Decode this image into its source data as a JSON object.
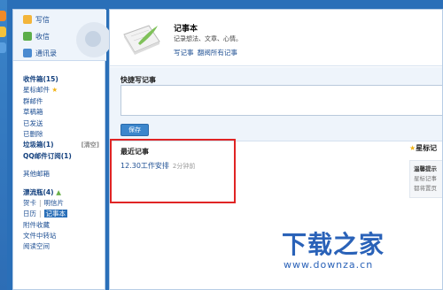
{
  "actions": {
    "write": "写信",
    "receive": "收信",
    "contacts": "通讯录"
  },
  "folders": {
    "inbox": "收件箱(15)",
    "starred": "星标邮件",
    "group": "群邮件",
    "drafts": "草稿箱",
    "sent": "已发送",
    "deleted": "已删除",
    "junk": "垃圾箱(1)",
    "junk_clear": "[清空]",
    "qq_sub": "QQ邮件订阅(1)",
    "other": "其他邮箱",
    "drift": "漂流瓶(4)",
    "card": "贺卡",
    "postcard": "明信片",
    "calendar": "日历",
    "notebook": "记事本",
    "attach": "附件收藏",
    "transfer": "文件中转站",
    "reading": "阅读空间"
  },
  "notebook": {
    "title": "记事本",
    "desc": "记录想法、文章、心情。",
    "write_link": "写记事",
    "browse_link": "翻阅所有记事"
  },
  "quick": {
    "title": "快捷写记事",
    "save": "保存"
  },
  "recent": {
    "title": "最近记事",
    "item": "12.30工作安排",
    "time": "2分钟前"
  },
  "side": {
    "title": "星标记",
    "line1": "温馨提示",
    "line2": "星标记事",
    "line3": "都将置页"
  },
  "watermark": {
    "logo": "下载之家",
    "url": "www.downza.cn"
  },
  "colors": {
    "accent": "#2a6fb8",
    "highlight": "#e02424",
    "link": "#1e4f93"
  }
}
